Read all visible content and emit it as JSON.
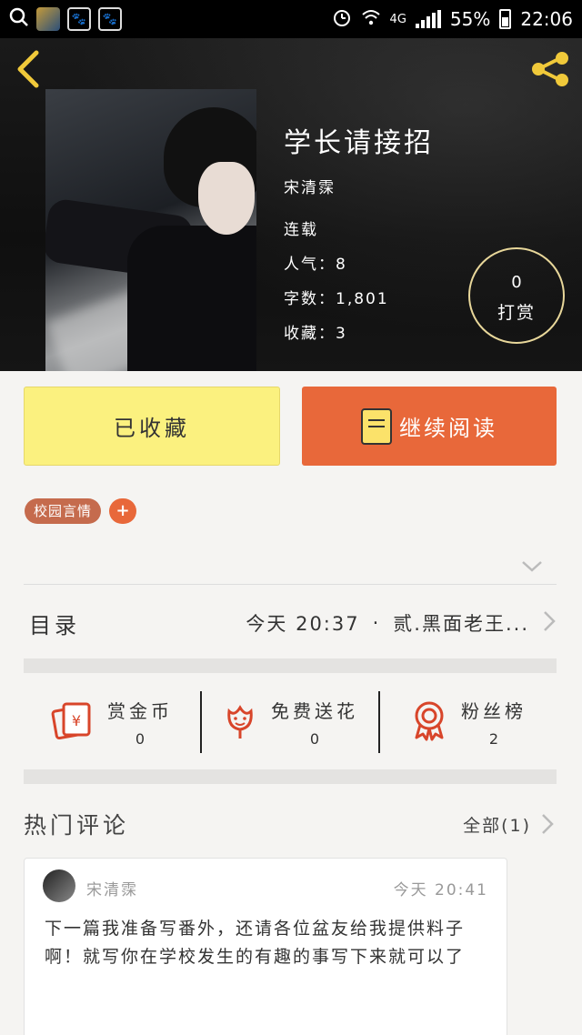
{
  "status_bar": {
    "battery": "55%",
    "network": "4G",
    "time": "22:06"
  },
  "book": {
    "title": "学长请接招",
    "author": "宋清霂",
    "status": "连载",
    "popularity": "人气：8",
    "word_count": "字数：1,801",
    "favorites": "收藏：3"
  },
  "tip": {
    "count": "0",
    "label": "打赏"
  },
  "actions": {
    "collected_label": "已收藏",
    "continue_label": "继续阅读"
  },
  "tags": [
    "校园言情"
  ],
  "tag_add": "+",
  "catalog": {
    "label": "目录",
    "time": "今天 20:37",
    "separator": "·",
    "latest_chapter": "贰.黑面老王..."
  },
  "stats": [
    {
      "label": "赏金币",
      "value": "0",
      "icon": "red-envelope-icon"
    },
    {
      "label": "免费送花",
      "value": "0",
      "icon": "flower-icon"
    },
    {
      "label": "粉丝榜",
      "value": "2",
      "icon": "medal-icon"
    }
  ],
  "comments": {
    "title": "热门评论",
    "all_label": "全部(1)",
    "items": [
      {
        "name": "宋清霂",
        "time": "今天 20:41",
        "text": "下一篇我准备写番外，还请各位盆友给我提供料子啊！就写你在学校发生的有趣的事写下来就可以了"
      }
    ]
  },
  "colors": {
    "accent_orange": "#e8683a",
    "collected_yellow": "#fbf17f",
    "tag_brown": "#c56b4d",
    "icon_red": "#d8452a"
  }
}
